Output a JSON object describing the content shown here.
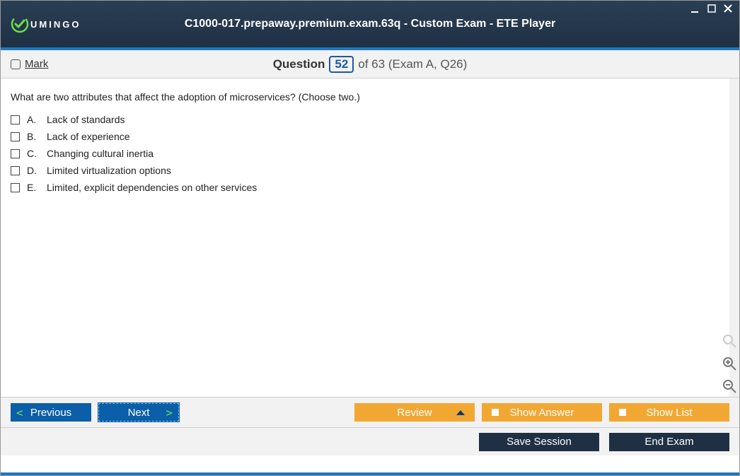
{
  "window": {
    "title": "C1000-017.prepaway.premium.exam.63q - Custom Exam - ETE Player",
    "logo_text": "UMINGO"
  },
  "question_bar": {
    "mark_label": "Mark",
    "question_word": "Question",
    "current_number": "52",
    "of_text": "of 63 (Exam A, Q26)"
  },
  "question": {
    "text": "What are two attributes that affect the adoption of microservices? (Choose two.)",
    "answers": [
      {
        "letter": "A.",
        "text": "Lack of standards"
      },
      {
        "letter": "B.",
        "text": "Lack of experience"
      },
      {
        "letter": "C.",
        "text": "Changing cultural inertia"
      },
      {
        "letter": "D.",
        "text": "Limited virtualization options"
      },
      {
        "letter": "E.",
        "text": "Limited, explicit dependencies on other services"
      }
    ]
  },
  "buttons": {
    "previous": "Previous",
    "next": "Next",
    "review": "Review",
    "show_answer": "Show Answer",
    "show_list": "Show List",
    "save_session": "Save Session",
    "end_exam": "End Exam"
  }
}
